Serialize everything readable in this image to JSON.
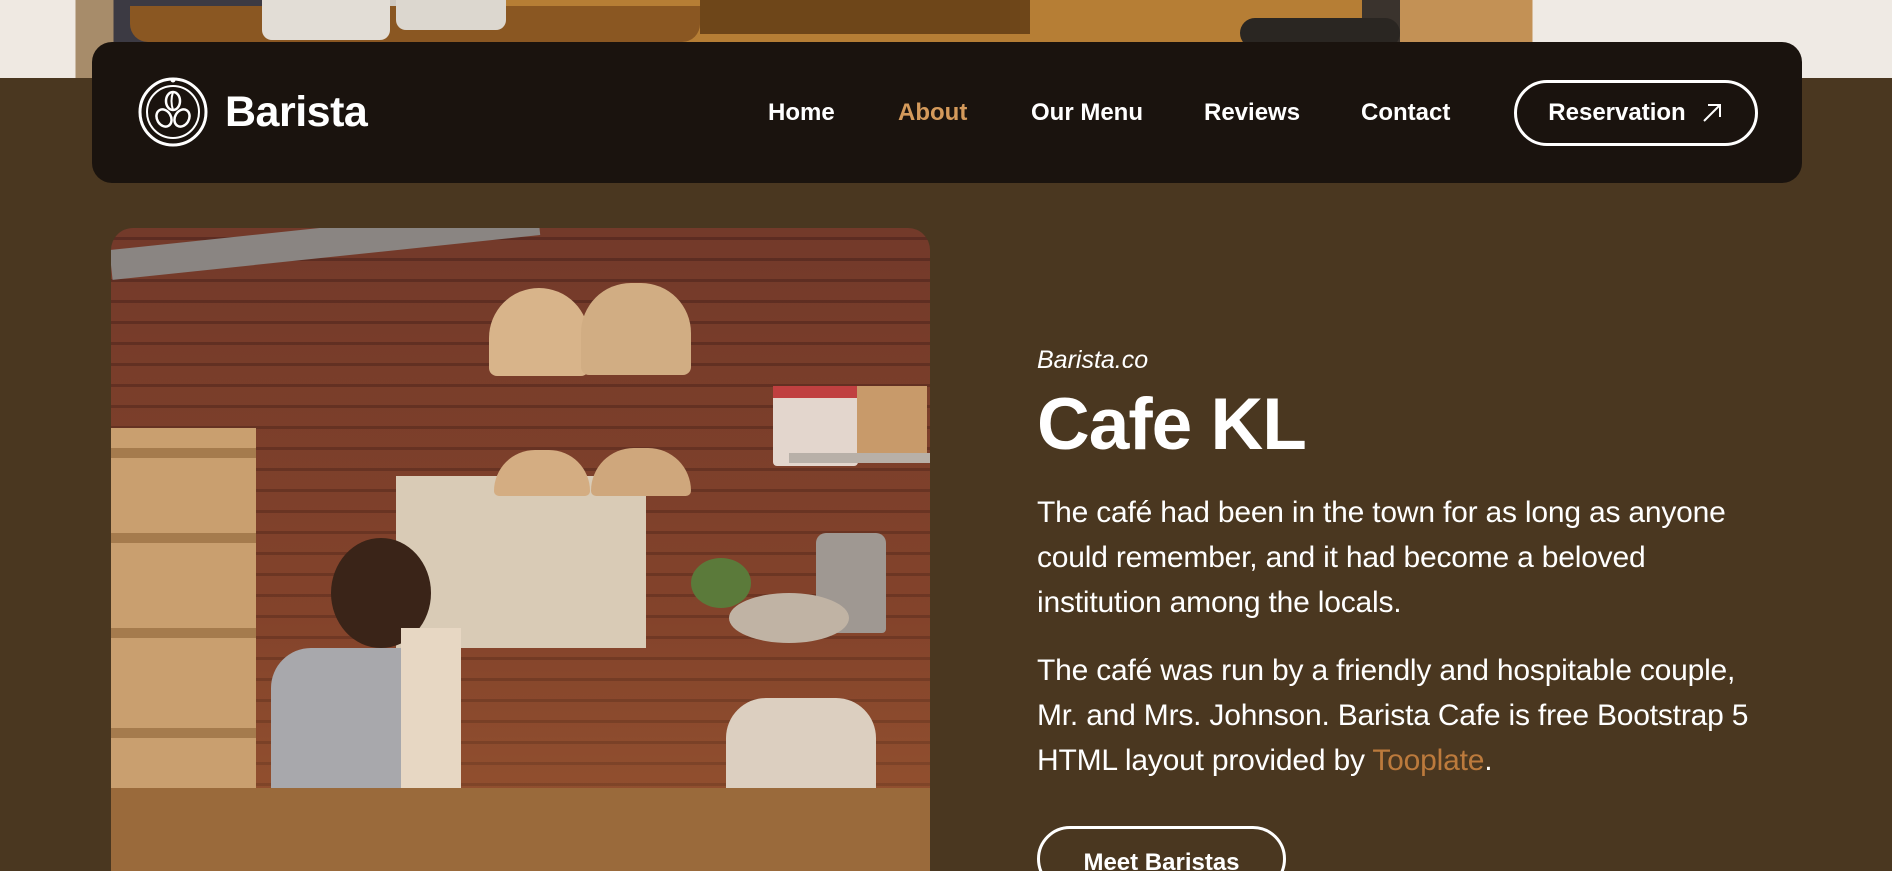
{
  "brand": {
    "name": "Barista",
    "logo_icon": "coffee-beans-logo"
  },
  "nav": {
    "items": [
      {
        "label": "Home",
        "active": false
      },
      {
        "label": "About",
        "active": true
      },
      {
        "label": "Our Menu",
        "active": false
      },
      {
        "label": "Reviews",
        "active": false
      },
      {
        "label": "Contact",
        "active": false
      }
    ],
    "reservation_label": "Reservation",
    "reservation_icon": "arrow-up-right-icon"
  },
  "about": {
    "subtitle": "Barista.co",
    "title": "Cafe KL",
    "paragraph_1": "The café had been in the town for as long as anyone could remember, and it had become a beloved institution among the locals.",
    "paragraph_2_text": "The café was run by a friendly and hospitable couple, Mr. and Mrs. Johnson. Barista Cafe is free Bootstrap 5 HTML layout provided by ",
    "paragraph_2_link": "Tooplate",
    "paragraph_2_end": ".",
    "cta_label": "Meet Baristas"
  },
  "colors": {
    "background": "#4a3720",
    "navbar": "#1a130e",
    "accent": "#d49a5b",
    "link": "#bc7a3c"
  }
}
